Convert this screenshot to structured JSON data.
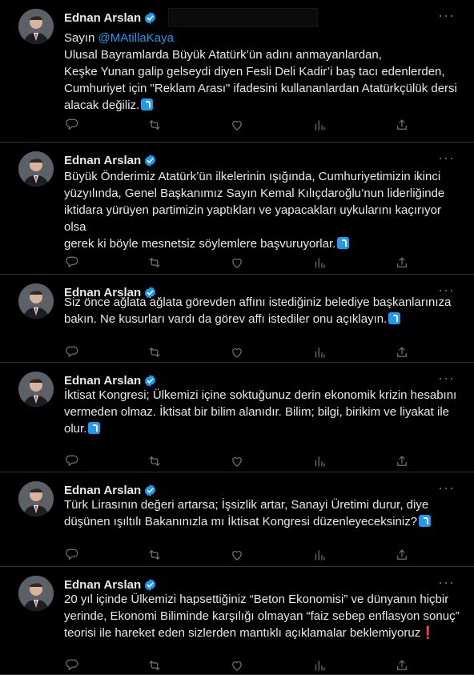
{
  "tweets": [
    {
      "author": "Ednan Arslan",
      "prefix": "Sayın ",
      "mention": "@MAtillaKaya",
      "lines": [
        "Ulusal Bayramlarda Büyük Atatürk’ün adını anmayanlardan,",
        "Keşke Yunan galip gelseydi diyen Fesli Deli Kadir’i baş tacı edenlerden,",
        "Cumhuriyet için \"Reklam Arası\" ifadesini kullananlardan Atatürkçülük dersi",
        "alacak değiliz."
      ],
      "end_emoji": "curve-arrow"
    },
    {
      "author": "Ednan Arslan",
      "lines": [
        "Büyük Önderimiz Atatürk’ün ilkelerinin ışığında, Cumhuriyetimizin ikinci",
        "yüzyılında, Genel Başkanımız Sayın Kemal Kılıçdaroğlu’nun liderliğinde",
        "iktidara yürüyen partimizin yaptıkları ve yapacakları uykularını kaçırıyor olsa",
        "gerek ki böyle mesnetsiz söylemlere başvuruyorlar."
      ],
      "end_emoji": "curve-arrow"
    },
    {
      "author": "Ednan Arslan",
      "lines": [
        "Siz önce ağlata ağlata görevden affını istediğiniz belediye başkanlarınıza",
        "bakın. Ne kusurları vardı da görev affı istediler onu açıklayın."
      ],
      "end_emoji": "curve-arrow"
    },
    {
      "author": "Ednan Arslan",
      "lines": [
        "İktisat Kongresi; Ülkemizi içine soktuğunuz derin ekonomik krizin hesabını",
        "vermeden olmaz. İktisat bir bilim alanıdır. Bilim; bilgi, birikim ve liyakat ile",
        "olur."
      ],
      "end_emoji": "curve-arrow"
    },
    {
      "author": "Ednan Arslan",
      "lines": [
        "Türk Lirasının değeri artarsa; İşsizlik artar, Sanayi Üretimi durur, diye",
        "düşünen ışıltılı Bakanınızla mı İktisat Kongresi düzenleyeceksiniz?"
      ],
      "end_emoji": "curve-arrow"
    },
    {
      "author": "Ednan Arslan",
      "lines": [
        "20 yıl içinde Ülkemizi hapsettiğiniz “Beton Ekonomisi” ve dünyanın hiçbir",
        "yerinde, Ekonomi Biliminde karşılığı olmayan “faiz sebep enflasyon sonuç”",
        "teorisi ile hareket eden sizlerden mantıklı açıklamalar beklemiyoruz"
      ],
      "end_emoji": "exclamation",
      "end_char": "❗"
    }
  ],
  "icons": {
    "reply": "reply-icon",
    "retweet": "retweet-icon",
    "like": "like-icon",
    "views": "views-icon",
    "share": "share-icon",
    "more": "more-icon",
    "verified": "verified-badge-icon"
  },
  "colors": {
    "background": "#000000",
    "text": "#e7e9ea",
    "muted": "#71767b",
    "accent": "#1d9bf0",
    "divider": "#2f3336"
  }
}
